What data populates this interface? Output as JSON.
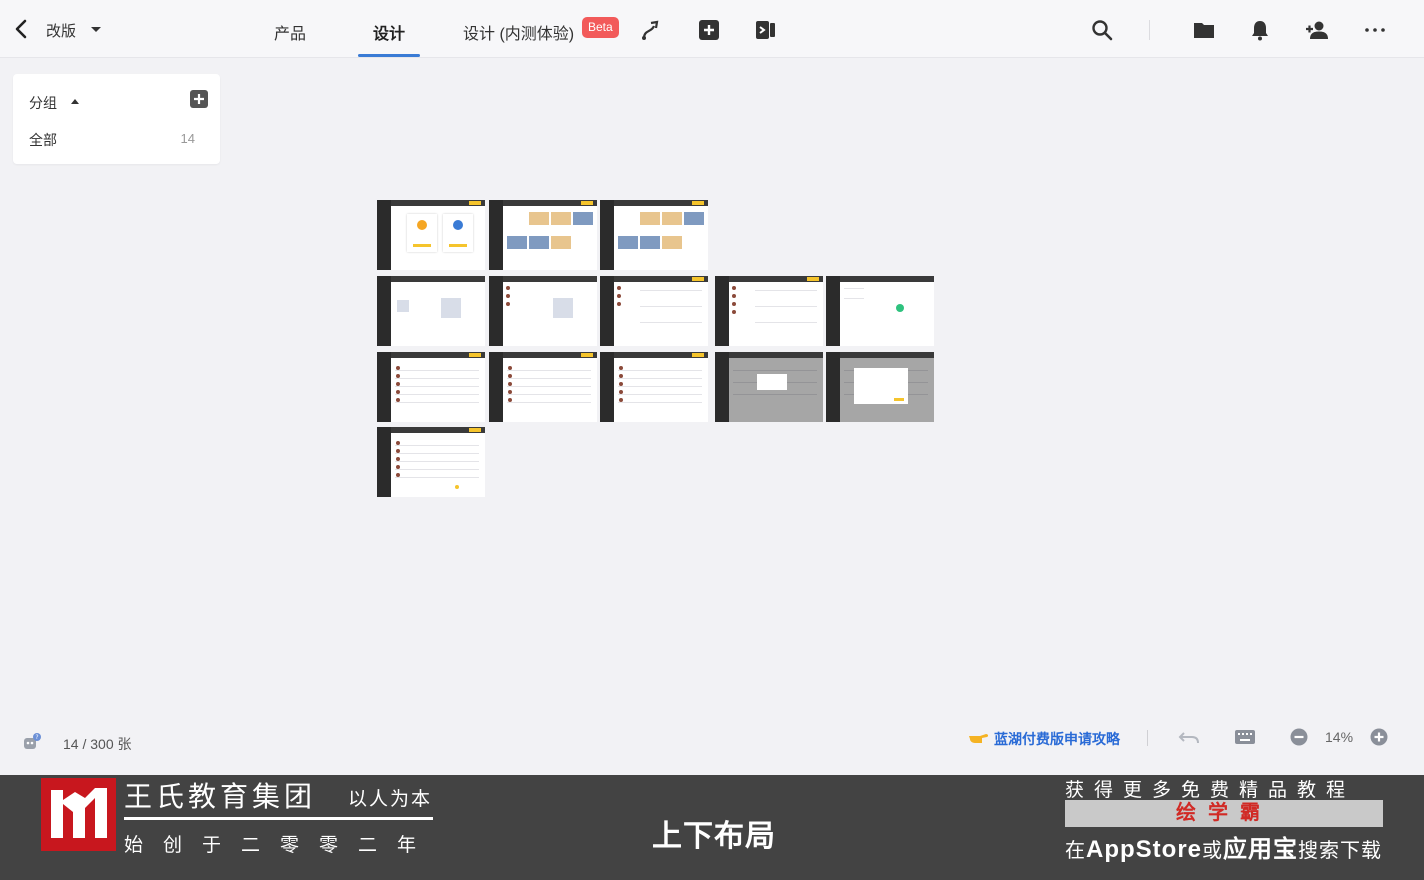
{
  "header": {
    "project": "改版",
    "tabs": [
      {
        "label": "产品",
        "active": false
      },
      {
        "label": "设计",
        "active": true
      },
      {
        "label": "设计 (内测体验)",
        "active": false
      }
    ],
    "beta_badge": "Beta",
    "accent_color": "#3a7bd5"
  },
  "sidebar": {
    "title": "分组",
    "items": [
      {
        "label": "全部",
        "count": "14"
      }
    ]
  },
  "canvas": {
    "artboard_count": 14
  },
  "statusbar": {
    "count_text": "14 / 300 张",
    "promo_text": "蓝湖付费版申请攻略",
    "zoom": "14%"
  },
  "banner": {
    "brand": "王氏教育集团",
    "slogan": "以人为本",
    "founded": "始创于二零零二年",
    "center_title": "上下布局",
    "right_line1": "获得更多免费精品教程",
    "right_line2": "绘学霸",
    "right_line3_pre": "在",
    "right_line3_app": "AppStore",
    "right_line3_mid": "或",
    "right_line3_store": "应用宝",
    "right_line3_post": "搜索下载"
  }
}
